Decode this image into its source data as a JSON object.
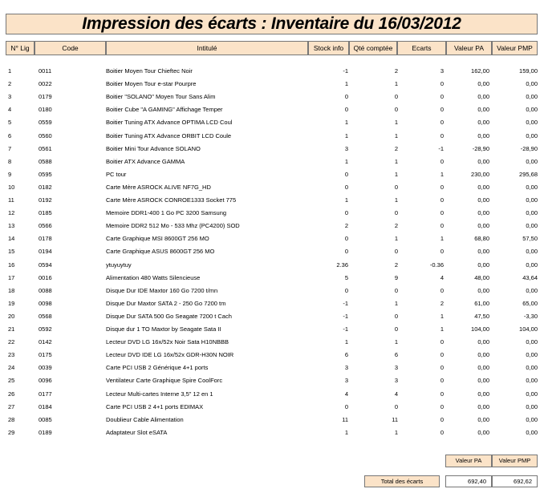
{
  "title": "Impression des écarts : Inventaire du 16/03/2012",
  "headers": {
    "lig": "N° Lig",
    "code": "Code",
    "intitule": "Intitulé",
    "stock": "Stock info",
    "qte": "Qté comptée",
    "ecarts": "Ecarts",
    "pa": "Valeur PA",
    "pmp": "Valeur PMP"
  },
  "rows": [
    [
      "1",
      "0011",
      "Boitier Moyen Tour Chieftec Noir",
      "-1",
      "2",
      "3",
      "162,00",
      "159,00"
    ],
    [
      "2",
      "0022",
      "Boitier Moyen Tour e-star Pourpre",
      "1",
      "1",
      "0",
      "0,00",
      "0,00"
    ],
    [
      "3",
      "0179",
      "Boitier \"SOLANO\" Moyen Tour Sans Alim",
      "0",
      "0",
      "0",
      "0,00",
      "0,00"
    ],
    [
      "4",
      "0180",
      "Boitier Cube \"A GAMING\" Affichage Temper",
      "0",
      "0",
      "0",
      "0,00",
      "0,00"
    ],
    [
      "5",
      "0559",
      "Boitier Tuning ATX Advance OPTIMA LCD Coul",
      "1",
      "1",
      "0",
      "0,00",
      "0,00"
    ],
    [
      "6",
      "0560",
      "Boitier Tuning ATX Advance ORBIT LCD Coule",
      "1",
      "1",
      "0",
      "0,00",
      "0,00"
    ],
    [
      "7",
      "0561",
      "Boitier Mini Tour Advance SOLANO",
      "3",
      "2",
      "-1",
      "-28,90",
      "-28,90"
    ],
    [
      "8",
      "0588",
      "Boitier ATX Advance GAMMA",
      "1",
      "1",
      "0",
      "0,00",
      "0,00"
    ],
    [
      "9",
      "0595",
      "PC tour",
      "0",
      "1",
      "1",
      "230,00",
      "295,68"
    ],
    [
      "10",
      "0182",
      "Carte Mère ASROCK ALIVE NF7G_HD",
      "0",
      "0",
      "0",
      "0,00",
      "0,00"
    ],
    [
      "11",
      "0192",
      "Carte Mère ASROCK CONROE1333 Socket 775",
      "1",
      "1",
      "0",
      "0,00",
      "0,00"
    ],
    [
      "12",
      "0185",
      "Memoire DDR1-400 1 Go PC 3200 Samsung",
      "0",
      "0",
      "0",
      "0,00",
      "0,00"
    ],
    [
      "13",
      "0566",
      "Memoire DDR2 512 Mo - 533 Mhz (PC4200) SOD",
      "2",
      "2",
      "0",
      "0,00",
      "0,00"
    ],
    [
      "14",
      "0178",
      "Carte Graphique MSI 8600GT 256 MO",
      "0",
      "1",
      "1",
      "68,80",
      "57,50"
    ],
    [
      "15",
      "0194",
      "Carte Graphique ASUS 8600GT 256 MO",
      "0",
      "0",
      "0",
      "0,00",
      "0,00"
    ],
    [
      "16",
      "0594",
      "ytuyuytuy",
      "2.36",
      "2",
      "-0.36",
      "0,00",
      "0,00"
    ],
    [
      "17",
      "0016",
      "Alimentation 480 Watts Silencieuse",
      "5",
      "9",
      "4",
      "48,00",
      "43,64"
    ],
    [
      "18",
      "0088",
      "Disque Dur IDE Maxtor 160 Go 7200 t/mn",
      "0",
      "0",
      "0",
      "0,00",
      "0,00"
    ],
    [
      "19",
      "0098",
      "Disque Dur Maxtor SATA 2 - 250 Go 7200 tm",
      "-1",
      "1",
      "2",
      "61,00",
      "65,00"
    ],
    [
      "20",
      "0568",
      "Disque Dur SATA 500 Go Seagate 7200 t Cach",
      "-1",
      "0",
      "1",
      "47,50",
      "-3,30"
    ],
    [
      "21",
      "0592",
      "Disque dur 1 TO Maxtor by Seagate Sata II",
      "-1",
      "0",
      "1",
      "104,00",
      "104,00"
    ],
    [
      "22",
      "0142",
      "Lecteur DVD LG 16x/52x Noir Sata H10NBBB",
      "1",
      "1",
      "0",
      "0,00",
      "0,00"
    ],
    [
      "23",
      "0175",
      "Lecteur DVD IDE LG 16x/52x GDR-H30N NOIR",
      "6",
      "6",
      "0",
      "0,00",
      "0,00"
    ],
    [
      "24",
      "0039",
      "Carte PCI USB 2 Générique 4+1 ports",
      "3",
      "3",
      "0",
      "0,00",
      "0,00"
    ],
    [
      "25",
      "0096",
      "Ventilateur Carte Graphique Spire CoolForc",
      "3",
      "3",
      "0",
      "0,00",
      "0,00"
    ],
    [
      "26",
      "0177",
      "Lecteur Multi-cartes Interne 3,5\" 12 en 1",
      "4",
      "4",
      "0",
      "0,00",
      "0,00"
    ],
    [
      "27",
      "0184",
      "Carte PCI USB 2 4+1 ports EDIMAX",
      "0",
      "0",
      "0",
      "0,00",
      "0,00"
    ],
    [
      "28",
      "0085",
      "Doublieur Cable Alimentation",
      "11",
      "11",
      "0",
      "0,00",
      "0,00"
    ],
    [
      "29",
      "0189",
      "Adaptateur Slot eSATA",
      "1",
      "1",
      "0",
      "0,00",
      "0,00"
    ]
  ],
  "totals": {
    "pa_header": "Valeur PA",
    "pmp_header": "Valeur PMP",
    "label": "Total des écarts",
    "pa": "692,40",
    "pmp": "692,62"
  }
}
